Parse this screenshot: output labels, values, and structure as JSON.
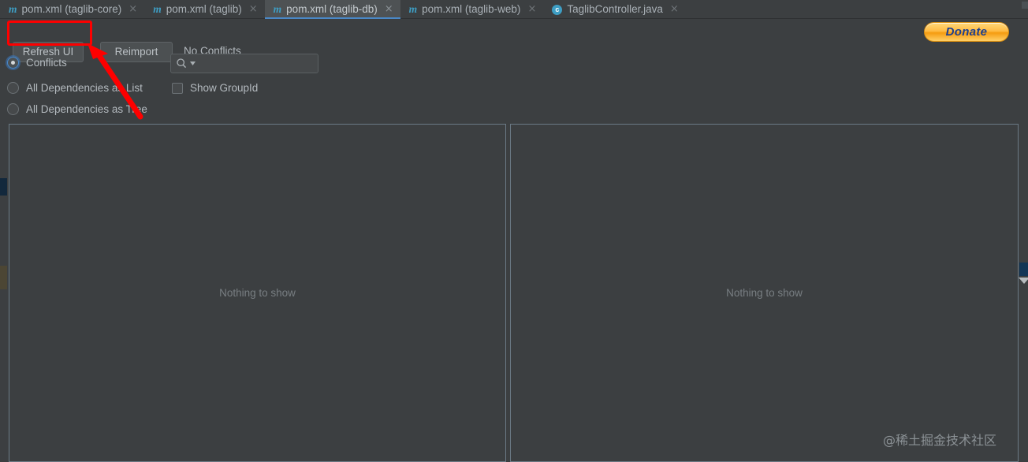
{
  "window": {
    "background_color": "#3c3f41",
    "accent_color": "#4a88c7"
  },
  "tabs": [
    {
      "label": "pom.xml (taglib-core)",
      "icon": "maven-icon",
      "icon_glyph": "m",
      "close_glyph": "×",
      "active": false
    },
    {
      "label": "pom.xml (taglib)",
      "icon": "maven-icon",
      "icon_glyph": "m",
      "close_glyph": "×",
      "active": false
    },
    {
      "label": "pom.xml (taglib-db)",
      "icon": "maven-icon",
      "icon_glyph": "m",
      "close_glyph": "×",
      "active": true
    },
    {
      "label": "pom.xml (taglib-web)",
      "icon": "maven-icon",
      "icon_glyph": "m",
      "close_glyph": "×",
      "active": false
    },
    {
      "label": "TaglibController.java",
      "icon": "java-class-icon",
      "icon_glyph": "c",
      "close_glyph": "×",
      "active": false
    }
  ],
  "toolbar": {
    "refresh_label": "Refresh UI",
    "reimport_label": "Reimport",
    "status_label": "No Conflicts",
    "donate_label": "Donate"
  },
  "options": {
    "radios": [
      {
        "label": "Conflicts",
        "selected": true
      },
      {
        "label": "All Dependencies as List",
        "selected": false
      },
      {
        "label": "All Dependencies as Tree",
        "selected": false
      }
    ],
    "checkbox": {
      "label": "Show GroupId",
      "checked": false
    }
  },
  "search": {
    "value": "",
    "placeholder": "",
    "icon": "search-icon"
  },
  "panels": {
    "left": {
      "empty_text": "Nothing to show"
    },
    "right": {
      "empty_text": "Nothing to show"
    }
  },
  "watermark": {
    "text": "@稀土掘金技术社区"
  },
  "annotation": {
    "highlight_target": "Refresh UI",
    "color": "#fe0000"
  }
}
